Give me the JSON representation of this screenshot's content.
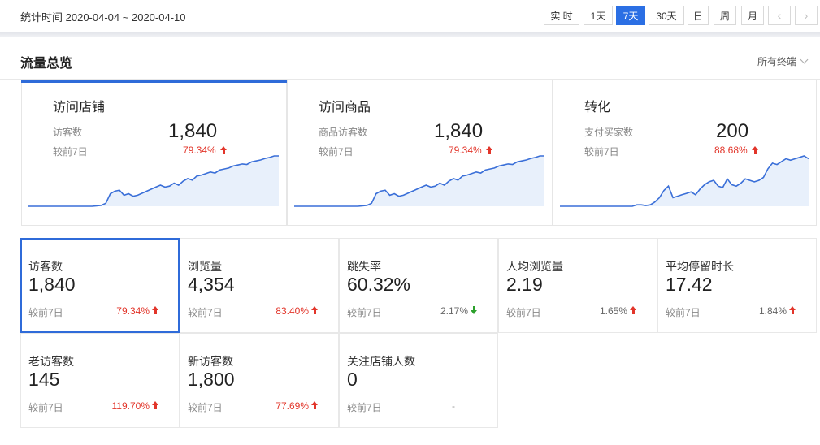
{
  "date_range": {
    "label": "统计时间",
    "start": "2020-04-04",
    "separator": "~",
    "end": "2020-04-10"
  },
  "range_buttons": [
    {
      "label": "实 时",
      "active": false
    },
    {
      "label": "1天",
      "active": false
    },
    {
      "label": "7天",
      "active": true
    },
    {
      "label": "30天",
      "active": false
    },
    {
      "label": "日",
      "active": false
    },
    {
      "label": "周",
      "active": false
    },
    {
      "label": "月",
      "active": false
    }
  ],
  "nav": {
    "prev_icon": "chevron-left-icon",
    "next_icon": "chevron-right-icon"
  },
  "section": {
    "title": "流量总览",
    "terminal_select": "所有终端"
  },
  "overview_cards": [
    {
      "title": "访问店铺",
      "metric_label": "访客数",
      "value": "1,840",
      "compare_label": "较前7日",
      "change": "79.34%",
      "trend": "up",
      "active": true,
      "sparkline": [
        0,
        0,
        0,
        0,
        0,
        0,
        0,
        0,
        0,
        0,
        0,
        0,
        0,
        0,
        0,
        1,
        2,
        6,
        25,
        30,
        32,
        22,
        25,
        20,
        22,
        26,
        30,
        34,
        38,
        42,
        38,
        40,
        46,
        42,
        50,
        55,
        52,
        60,
        62,
        65,
        68,
        66,
        72,
        74,
        76,
        80,
        82,
        84,
        83,
        88,
        90,
        92,
        95,
        97,
        100,
        100
      ]
    },
    {
      "title": "访问商品",
      "metric_label": "商品访客数",
      "value": "1,840",
      "compare_label": "较前7日",
      "change": "79.34%",
      "trend": "up",
      "active": false,
      "sparkline": [
        0,
        0,
        0,
        0,
        0,
        0,
        0,
        0,
        0,
        0,
        0,
        0,
        0,
        0,
        0,
        1,
        2,
        6,
        25,
        30,
        32,
        22,
        25,
        20,
        22,
        26,
        30,
        34,
        38,
        42,
        38,
        40,
        46,
        42,
        50,
        55,
        52,
        60,
        62,
        65,
        68,
        66,
        72,
        74,
        76,
        80,
        82,
        84,
        83,
        88,
        90,
        92,
        95,
        97,
        100,
        100
      ]
    },
    {
      "title": "转化",
      "metric_label": "支付买家数",
      "value": "200",
      "compare_label": "较前7日",
      "change": "88.68%",
      "trend": "up",
      "active": false,
      "sparkline": [
        0,
        0,
        0,
        0,
        0,
        0,
        0,
        0,
        0,
        0,
        0,
        0,
        0,
        0,
        0,
        0,
        0,
        2,
        2,
        1,
        2,
        6,
        12,
        22,
        28,
        12,
        14,
        16,
        18,
        20,
        16,
        24,
        30,
        34,
        36,
        28,
        26,
        38,
        30,
        28,
        32,
        38,
        36,
        34,
        36,
        40,
        52,
        60,
        58,
        62,
        66,
        64,
        66,
        68,
        70,
        66
      ]
    }
  ],
  "metrics": [
    {
      "label": "访客数",
      "value": "1,840",
      "compare_label": "较前7日",
      "change": "79.34%",
      "trend": "up",
      "selected": true
    },
    {
      "label": "浏览量",
      "value": "4,354",
      "compare_label": "较前7日",
      "change": "83.40%",
      "trend": "up",
      "selected": false
    },
    {
      "label": "跳失率",
      "value": "60.32%",
      "compare_label": "较前7日",
      "change": "2.17%",
      "trend": "down",
      "selected": false
    },
    {
      "label": "人均浏览量",
      "value": "2.19",
      "compare_label": "较前7日",
      "change": "1.65%",
      "trend": "up",
      "selected": false
    },
    {
      "label": "平均停留时长",
      "value": "17.42",
      "compare_label": "较前7日",
      "change": "1.84%",
      "trend": "up",
      "selected": false
    },
    {
      "label": "老访客数",
      "value": "145",
      "compare_label": "较前7日",
      "change": "119.70%",
      "trend": "up",
      "selected": false
    },
    {
      "label": "新访客数",
      "value": "1,800",
      "compare_label": "较前7日",
      "change": "77.69%",
      "trend": "up",
      "selected": false
    },
    {
      "label": "关注店铺人数",
      "value": "0",
      "compare_label": "较前7日",
      "change": "-",
      "trend": "none",
      "selected": false
    }
  ],
  "colors": {
    "accent": "#2f6bd9",
    "up": "#e2352a",
    "down": "#2ca02c",
    "spark_line": "#3a6fd8",
    "spark_fill": "#e8f0fb"
  }
}
